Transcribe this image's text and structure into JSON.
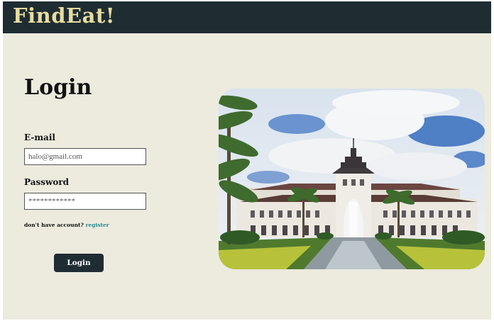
{
  "header": {
    "brand": "FindEat!"
  },
  "login": {
    "title": "Login",
    "email_label": "E-mail",
    "email_value": "halo@gmail.com",
    "password_label": "Password",
    "password_value": "************",
    "no_account_text": "don't have account?",
    "register_link": "register",
    "submit_label": "Login"
  },
  "colors": {
    "topbar": "#1f2d33",
    "brand": "#e7dca0",
    "background": "#ecebde",
    "link": "#2b8a92"
  }
}
